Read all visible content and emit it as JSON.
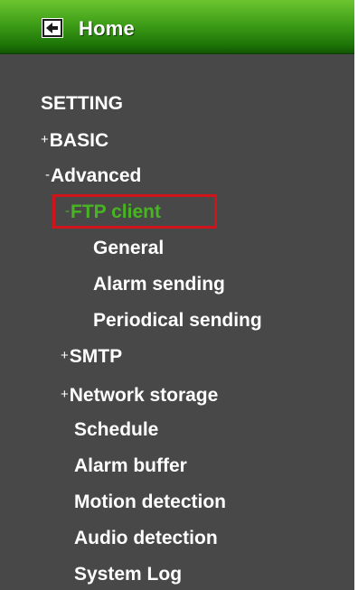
{
  "header": {
    "home_label": "Home",
    "home_icon": "back-arrow-icon"
  },
  "colors": {
    "panel_bg": "#484848",
    "header_green": "#2f8a10",
    "active_text": "#47b521",
    "highlight_border": "#d1141c"
  },
  "menu": {
    "setting": "SETTING",
    "basic_sign": "+",
    "basic": "BASIC",
    "advanced_sign": "-",
    "advanced": "Advanced",
    "ftp_client_sign": "-",
    "ftp_client": "FTP client",
    "ftp_general": "General",
    "ftp_alarm_sending": "Alarm sending",
    "ftp_periodical_sending": "Periodical sending",
    "smtp_sign": "+",
    "smtp": "SMTP",
    "network_storage_sign": "+",
    "network_storage": "Network storage",
    "schedule": "Schedule",
    "alarm_buffer": "Alarm buffer",
    "motion_detection": "Motion detection",
    "audio_detection": "Audio detection",
    "system_log": "System Log"
  }
}
